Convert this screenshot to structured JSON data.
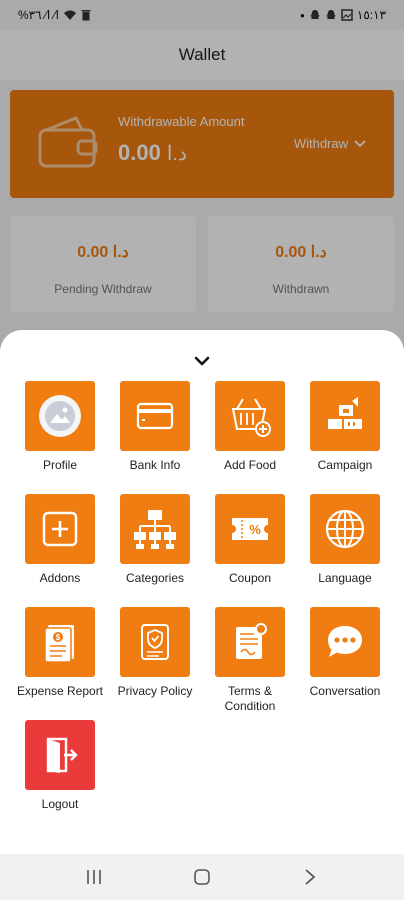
{
  "status_bar": {
    "left_text": "%٣٦ ⁄ⅼ ⁄ⅼ",
    "right_time": "١٥:١٣"
  },
  "app_bar": {
    "title": "Wallet"
  },
  "wallet_card": {
    "label": "Withdrawable Amount",
    "amount": "0.00",
    "currency": "د.ا",
    "withdraw_label": "Withdraw"
  },
  "stats": [
    {
      "value": "0.00 د.ا",
      "label": "Pending Withdraw"
    },
    {
      "value": "0.00 د.ا",
      "label": "Withdrawn"
    }
  ],
  "menu": {
    "items": [
      {
        "label": "Profile",
        "icon": "profile-icon"
      },
      {
        "label": "Bank Info",
        "icon": "bank-card-icon"
      },
      {
        "label": "Add Food",
        "icon": "add-food-basket-icon"
      },
      {
        "label": "Campaign",
        "icon": "campaign-icon"
      },
      {
        "label": "Addons",
        "icon": "addons-icon"
      },
      {
        "label": "Categories",
        "icon": "categories-icon"
      },
      {
        "label": "Coupon",
        "icon": "coupon-icon"
      },
      {
        "label": "Language",
        "icon": "language-globe-icon"
      },
      {
        "label": "Expense Report",
        "icon": "expense-report-icon"
      },
      {
        "label": "Privacy Policy",
        "icon": "privacy-policy-icon"
      },
      {
        "label": "Terms & Condition",
        "icon": "terms-icon"
      },
      {
        "label": "Conversation",
        "icon": "conversation-icon"
      },
      {
        "label": "Logout",
        "icon": "logout-icon"
      }
    ]
  },
  "colors": {
    "accent": "#f07d12",
    "logout": "#ea3a3a"
  }
}
